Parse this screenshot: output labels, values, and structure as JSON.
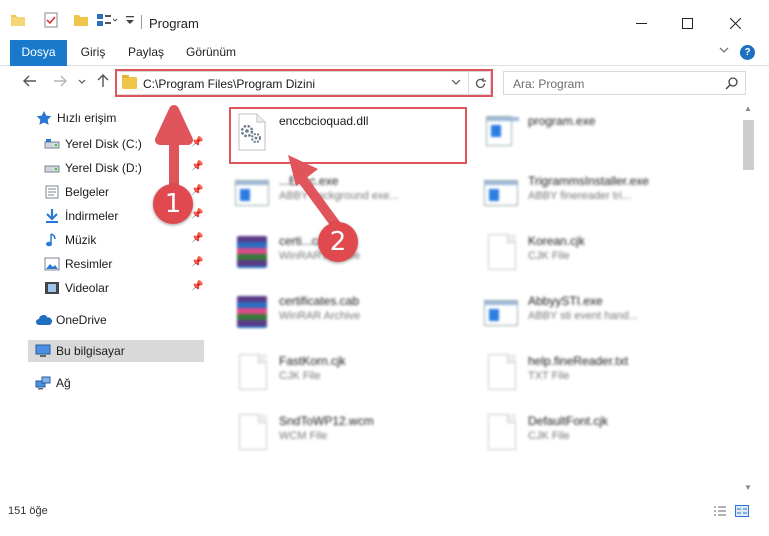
{
  "window": {
    "title": "Program",
    "minimize": "—",
    "maximize": "☐",
    "close": "✕"
  },
  "ribbon": {
    "tabs": [
      "Dosya",
      "Giriş",
      "Paylaş",
      "Görünüm"
    ],
    "collapse": "⌄",
    "help": "?"
  },
  "nav": {
    "back": "←",
    "forward": "→",
    "recent": "⌄",
    "up": "↑",
    "address": "C:\\Program Files\\Program Dizini",
    "address_dropdown": "⌄",
    "refresh": "↻",
    "search_placeholder": "Ara: Program"
  },
  "sidebar": {
    "items": [
      {
        "label": "Hızlı erişim",
        "icon": "star-icon",
        "pinned": false
      },
      {
        "label": "Yerel Disk (C:)",
        "icon": "drive-icon",
        "pinned": true
      },
      {
        "label": "Yerel Disk (D:)",
        "icon": "drive-icon",
        "pinned": true
      },
      {
        "label": "Belgeler",
        "icon": "documents-icon",
        "pinned": true
      },
      {
        "label": "İndirmeler",
        "icon": "download-icon",
        "pinned": true
      },
      {
        "label": "Müzik",
        "icon": "music-icon",
        "pinned": true
      },
      {
        "label": "Resimler",
        "icon": "pictures-icon",
        "pinned": true
      },
      {
        "label": "Videolar",
        "icon": "videos-icon",
        "pinned": true
      },
      {
        "label": "OneDrive",
        "icon": "cloud-icon",
        "pinned": false
      },
      {
        "label": "Bu bilgisayar",
        "icon": "computer-icon",
        "pinned": false,
        "selected": true
      },
      {
        "label": "Ağ",
        "icon": "network-icon",
        "pinned": false
      }
    ]
  },
  "files": [
    {
      "name": "enccbcioquad.dll",
      "type": "",
      "icon": "dll-gear-icon",
      "highlighted": true
    },
    {
      "name": "program.exe",
      "type": "",
      "icon": "exe-icon"
    },
    {
      "name": "...Exec.exe",
      "type": "ABBY background exe...",
      "icon": "exe-icon"
    },
    {
      "name": "TrigrammsInstaller.exe",
      "type": "ABBY finereader tri...",
      "icon": "exe-icon"
    },
    {
      "name": "certi...cab",
      "type": "WinRAR Archive",
      "icon": "rar-icon"
    },
    {
      "name": "Korean.cjk",
      "type": "CJK File",
      "icon": "document-icon"
    },
    {
      "name": "certificates.cab",
      "type": "WinRAR Archive",
      "icon": "rar-icon"
    },
    {
      "name": "AbbyySTI.exe",
      "type": "ABBY sti event hand...",
      "icon": "exe-icon"
    },
    {
      "name": "FastKorn.cjk",
      "type": "CJK File",
      "icon": "document-icon"
    },
    {
      "name": "help.fineReader.txt",
      "type": "TXT File",
      "icon": "document-icon"
    },
    {
      "name": "SndToWP12.wcm",
      "type": "WCM File",
      "icon": "document-icon"
    },
    {
      "name": "DefaultFont.cjk",
      "type": "CJK File",
      "icon": "document-icon"
    }
  ],
  "status": {
    "count": "151 öğe"
  },
  "annotations": {
    "step1": "1",
    "step2": "2",
    "color": "#e0555b"
  }
}
